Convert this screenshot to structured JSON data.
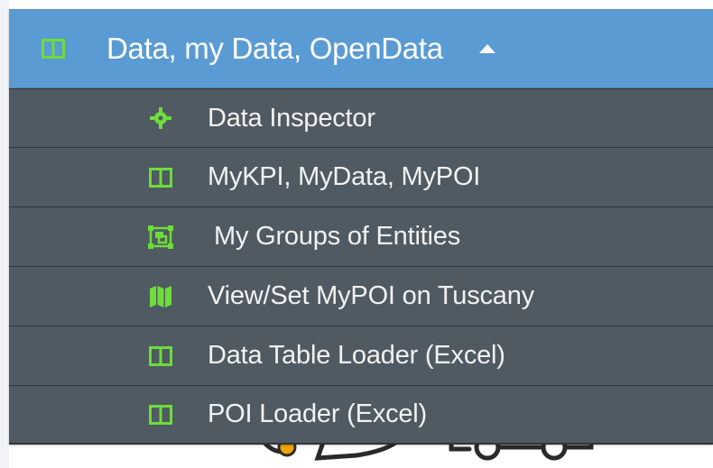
{
  "colors": {
    "header_bg": "#5a9bd3",
    "item_bg": "#505a62",
    "item_border": "#2f363b",
    "icon_green": "#6edc3a",
    "text": "#f2f2f2",
    "background_art": "#2a2a2a",
    "background_accent": "#f0a500"
  },
  "menu": {
    "header": {
      "icon": "table-columns-icon",
      "title": "Data, my Data, OpenData",
      "caret": "caret-up-icon"
    },
    "items": [
      {
        "icon": "crosshair-icon",
        "label": "Data Inspector"
      },
      {
        "icon": "table-columns-icon",
        "label": "MyKPI, MyData, MyPOI"
      },
      {
        "icon": "object-group-icon",
        "label": "My Groups of Entities"
      },
      {
        "icon": "map-icon",
        "label": "View/Set MyPOI on Tuscany"
      },
      {
        "icon": "table-columns-icon",
        "label": "Data Table Loader (Excel)"
      },
      {
        "icon": "table-columns-icon",
        "label": "POI Loader (Excel)"
      }
    ]
  }
}
